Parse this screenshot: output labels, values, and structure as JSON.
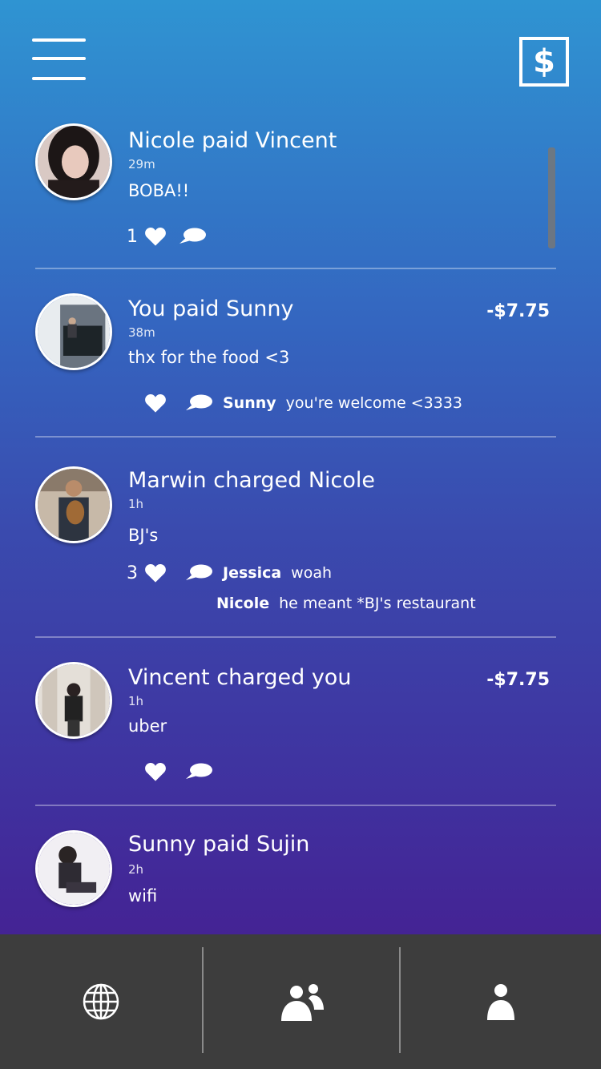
{
  "header": {
    "menu_icon": "hamburger-menu-icon",
    "pay_icon": "dollar-sign-icon",
    "pay_symbol": "$"
  },
  "feed": [
    {
      "title": "Nicole paid Vincent",
      "time": "29m",
      "note": "BOBA!!",
      "amount": "",
      "likes": "1",
      "comments": []
    },
    {
      "title": "You paid Sunny",
      "time": "38m",
      "note": "thx for the food <3",
      "amount": "-$7.75",
      "likes": "",
      "comments": [
        {
          "name": "Sunny",
          "text": "you're welcome <3333"
        }
      ]
    },
    {
      "title": "Marwin charged Nicole",
      "time": "1h",
      "note": "BJ's",
      "amount": "",
      "likes": "3",
      "comments": [
        {
          "name": "Jessica",
          "text": "woah"
        },
        {
          "name": "Nicole",
          "text": "he meant *BJ's restaurant"
        }
      ]
    },
    {
      "title": "Vincent charged you",
      "time": "1h",
      "note": "uber",
      "amount": "-$7.75",
      "likes": "",
      "comments": []
    },
    {
      "title": "Sunny paid Sujin",
      "time": "2h",
      "note": "wifi",
      "amount": "",
      "likes": "",
      "comments": []
    }
  ],
  "tabbar": {
    "tabs": [
      {
        "icon": "globe-icon",
        "label": "public"
      },
      {
        "icon": "friends-icon",
        "label": "friends"
      },
      {
        "icon": "person-icon",
        "label": "me"
      }
    ]
  },
  "colors": {
    "gradient_top": "#2f94d2",
    "gradient_bottom": "#48168a",
    "tabbar": "#3d3d3d",
    "text": "#ffffff"
  }
}
